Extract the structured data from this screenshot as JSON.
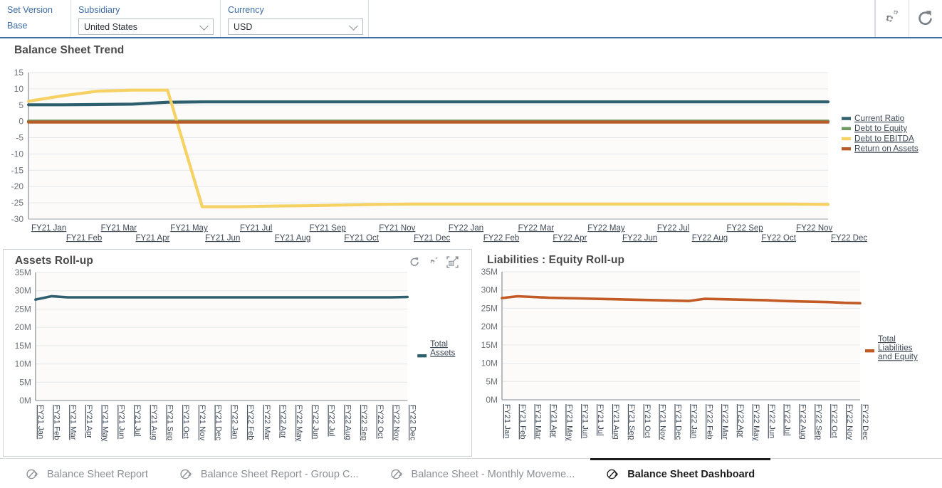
{
  "topbar": {
    "set_version_label": "Set Version",
    "set_version_value": "Base",
    "subsidiary_label": "Subsidiary",
    "subsidiary_value": "United States",
    "currency_label": "Currency",
    "currency_value": "USD",
    "settings_icon": "gear-icon",
    "refresh_icon": "refresh-icon"
  },
  "panels": {
    "trend_title": "Balance Sheet Trend",
    "assets_title": "Assets Roll-up",
    "liabilities_title": "Liabilities : Equity Roll-up",
    "assets_icons": [
      "refresh-icon",
      "gear-icon",
      "expand-icon"
    ]
  },
  "colors": {
    "current_ratio": "#2e5f6e",
    "debt_to_equity": "#6f9a63",
    "debt_to_ebitda": "#f6d264",
    "return_on_assets": "#b75c28",
    "total_assets": "#2e5f6e",
    "total_liabilities": "#c15a25",
    "accent": "#3b6ea5",
    "grid": "#e3e7eb",
    "plot_bg": "#fcfbf9",
    "axis_text": "#6b7177",
    "link_text": "#3f4a57"
  },
  "tabs": [
    {
      "label": "Balance Sheet Report",
      "active": false
    },
    {
      "label": "Balance Sheet Report - Group C...",
      "active": false
    },
    {
      "label": "Balance Sheet - Monthly Moveme...",
      "active": false
    },
    {
      "label": "Balance Sheet Dashboard",
      "active": true
    }
  ],
  "chart_data": [
    {
      "id": "balance-sheet-trend",
      "type": "line",
      "title": "Balance Sheet Trend",
      "xlabel": "",
      "ylabel": "",
      "ylim": [
        -30,
        15
      ],
      "yticks": [
        15,
        10,
        5,
        0,
        -5,
        -10,
        -15,
        -20,
        -25,
        -30
      ],
      "grid": true,
      "legend_position": "right",
      "categories": [
        "FY21 Jan",
        "FY21 Feb",
        "FY21 Mar",
        "FY21 Apr",
        "FY21 May",
        "FY21 Jun",
        "FY21 Jul",
        "FY21 Aug",
        "FY21 Sep",
        "FY21 Oct",
        "FY21 Nov",
        "FY21 Dec",
        "FY22 Jan",
        "FY22 Feb",
        "FY22 Mar",
        "FY22 Apr",
        "FY22 May",
        "FY22 Jun",
        "FY22 Jul",
        "FY22 Aug",
        "FY22 Sep",
        "FY22 Oct",
        "FY22 Nov",
        "FY22 Dec"
      ],
      "series": [
        {
          "name": "Current Ratio",
          "color": "#2e5f6e",
          "values": [
            5.1,
            5.1,
            5.2,
            5.3,
            5.9,
            6.0,
            6.0,
            6.0,
            6.0,
            6.0,
            6.0,
            6.0,
            6.0,
            6.0,
            6.0,
            6.0,
            6.0,
            6.0,
            6.0,
            6.0,
            6.0,
            6.0,
            6.0,
            6.0
          ]
        },
        {
          "name": "Debt to Equity",
          "color": "#6f9a63",
          "values": [
            0.1,
            0.1,
            0.1,
            0.1,
            0.1,
            0.1,
            0.1,
            0.1,
            0.1,
            0.1,
            0.1,
            0.1,
            0.1,
            0.1,
            0.1,
            0.1,
            0.1,
            0.1,
            0.1,
            0.1,
            0.1,
            0.1,
            0.1,
            0.1
          ]
        },
        {
          "name": "Debt to EBITDA",
          "color": "#f6d264",
          "values": [
            6.2,
            7.9,
            9.3,
            9.6,
            9.6,
            -26.2,
            -26.2,
            -26.0,
            -25.9,
            -25.7,
            -25.5,
            -25.4,
            -25.4,
            -25.4,
            -25.4,
            -25.4,
            -25.4,
            -25.4,
            -25.4,
            -25.4,
            -25.4,
            -25.4,
            -25.4,
            -25.5
          ]
        },
        {
          "name": "Return on Assets",
          "color": "#b75c28",
          "values": [
            -0.2,
            -0.2,
            -0.2,
            -0.2,
            -0.2,
            -0.2,
            -0.2,
            -0.2,
            -0.2,
            -0.2,
            -0.2,
            -0.2,
            -0.2,
            -0.2,
            -0.2,
            -0.2,
            -0.2,
            -0.2,
            -0.2,
            -0.2,
            -0.2,
            -0.2,
            -0.2,
            -0.2
          ]
        }
      ]
    },
    {
      "id": "assets-rollup",
      "type": "line",
      "title": "Assets Roll-up",
      "xlabel": "",
      "ylabel": "",
      "ylim": [
        0,
        35000000
      ],
      "yticks": [
        35000000,
        30000000,
        25000000,
        20000000,
        15000000,
        10000000,
        5000000,
        0
      ],
      "ytick_labels": [
        "35M",
        "30M",
        "25M",
        "20M",
        "15M",
        "10M",
        "5M",
        "0M"
      ],
      "grid": true,
      "legend_position": "right",
      "categories": [
        "FY21 Jan",
        "FY21 Feb",
        "FY21 Mar",
        "FY21 Apr",
        "FY21 May",
        "FY21 Jun",
        "FY21 Jul",
        "FY21 Aug",
        "FY21 Sep",
        "FY21 Oct",
        "FY21 Nov",
        "FY21 Dec",
        "FY22 Jan",
        "FY22 Feb",
        "FY22 Mar",
        "FY22 Apr",
        "FY22 May",
        "FY22 Jun",
        "FY22 Jul",
        "FY22 Aug",
        "FY22 Sep",
        "FY22 Oct",
        "FY22 Nov",
        "FY22 Dec"
      ],
      "series": [
        {
          "name": "Total Assets",
          "color": "#2e5f6e",
          "values": [
            27600000,
            28500000,
            28200000,
            28200000,
            28200000,
            28200000,
            28200000,
            28200000,
            28200000,
            28200000,
            28200000,
            28200000,
            28200000,
            28200000,
            28200000,
            28200000,
            28200000,
            28200000,
            28200000,
            28200000,
            28200000,
            28200000,
            28200000,
            28300000
          ]
        }
      ]
    },
    {
      "id": "liabilities-equity-rollup",
      "type": "line",
      "title": "Liabilities : Equity Roll-up",
      "xlabel": "",
      "ylabel": "",
      "ylim": [
        0,
        35000000
      ],
      "yticks": [
        35000000,
        30000000,
        25000000,
        20000000,
        15000000,
        10000000,
        5000000,
        0
      ],
      "ytick_labels": [
        "35M",
        "30M",
        "25M",
        "20M",
        "15M",
        "10M",
        "5M",
        "0M"
      ],
      "grid": true,
      "legend_position": "right",
      "categories": [
        "FY21 Jan",
        "FY21 Feb",
        "FY21 Mar",
        "FY21 Apr",
        "FY21 May",
        "FY21 Jun",
        "FY21 Jul",
        "FY21 Aug",
        "FY21 Sep",
        "FY21 Oct",
        "FY21 Nov",
        "FY21 Dec",
        "FY22 Jan",
        "FY22 Feb",
        "FY22 Mar",
        "FY22 Apr",
        "FY22 May",
        "FY22 Jun",
        "FY22 Jul",
        "FY22 Aug",
        "FY22 Sep",
        "FY22 Oct",
        "FY22 Nov",
        "FY22 Dec"
      ],
      "series": [
        {
          "name": "Total Liabilities and Equity",
          "color": "#c15a25",
          "values": [
            27800000,
            28300000,
            28100000,
            27900000,
            27800000,
            27700000,
            27600000,
            27500000,
            27400000,
            27300000,
            27200000,
            27100000,
            27000000,
            27600000,
            27500000,
            27400000,
            27300000,
            27200000,
            27000000,
            26900000,
            26800000,
            26700000,
            26500000,
            26400000
          ]
        }
      ]
    }
  ]
}
